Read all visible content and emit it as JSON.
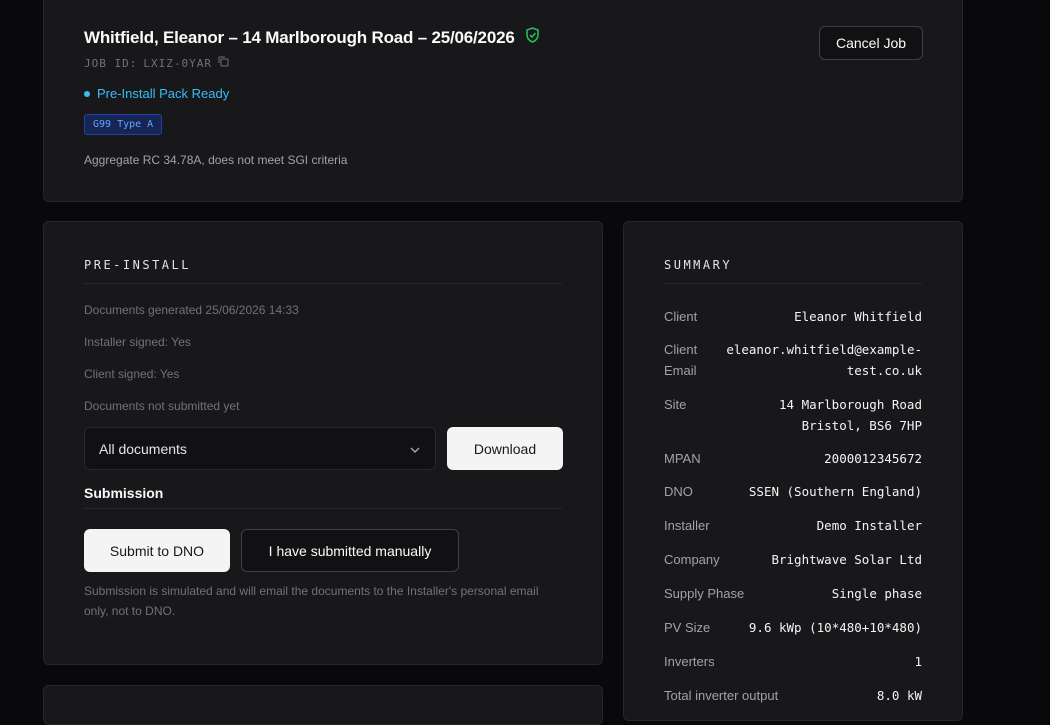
{
  "header": {
    "title": "Whitfield, Eleanor – 14 Marlborough Road – 25/06/2026",
    "job_id_label": "JOB ID:",
    "job_id": "LXIZ-0YAR",
    "status": "Pre-Install Pack Ready",
    "badge": "G99 Type A",
    "note": "Aggregate RC 34.78A, does not meet SGI criteria",
    "cancel_label": "Cancel Job"
  },
  "preinstall": {
    "heading": "PRE-INSTALL",
    "lines": [
      "Documents generated 25/06/2026 14:33",
      "Installer signed: Yes",
      "Client signed: Yes",
      "Documents not submitted yet"
    ],
    "select_value": "All documents",
    "download_label": "Download",
    "submission_heading": "Submission",
    "submit_dno_label": "Submit to DNO",
    "manual_label": "I have submitted manually",
    "disclaimer": "Submission is simulated and will email the documents to the Installer's personal email only, not to DNO."
  },
  "summary": {
    "heading": "SUMMARY",
    "rows": [
      {
        "label": "Client",
        "value": "Eleanor Whitfield"
      },
      {
        "label": "Client Email",
        "value": "eleanor.whitfield@example-\ntest.co.uk"
      },
      {
        "label": "Site",
        "value": "14 Marlborough Road\nBristol, BS6 7HP"
      },
      {
        "label": "MPAN",
        "value": "2000012345672"
      },
      {
        "label": "DNO",
        "value": "SSEN (Southern England)"
      },
      {
        "label": "Installer",
        "value": "Demo Installer"
      },
      {
        "label": "Company",
        "value": "Brightwave Solar Ltd"
      },
      {
        "label": "Supply Phase",
        "value": "Single phase"
      },
      {
        "label": "PV Size",
        "value": "9.6 kWp (10*480+10*480)"
      },
      {
        "label": "Inverters",
        "value": "1"
      },
      {
        "label": "Total inverter output",
        "value": "8.0 kW"
      }
    ]
  },
  "colors": {
    "accent_status": "#38bdf8",
    "verified": "#22c55e",
    "background": "#09090b",
    "card": "#18181b"
  }
}
